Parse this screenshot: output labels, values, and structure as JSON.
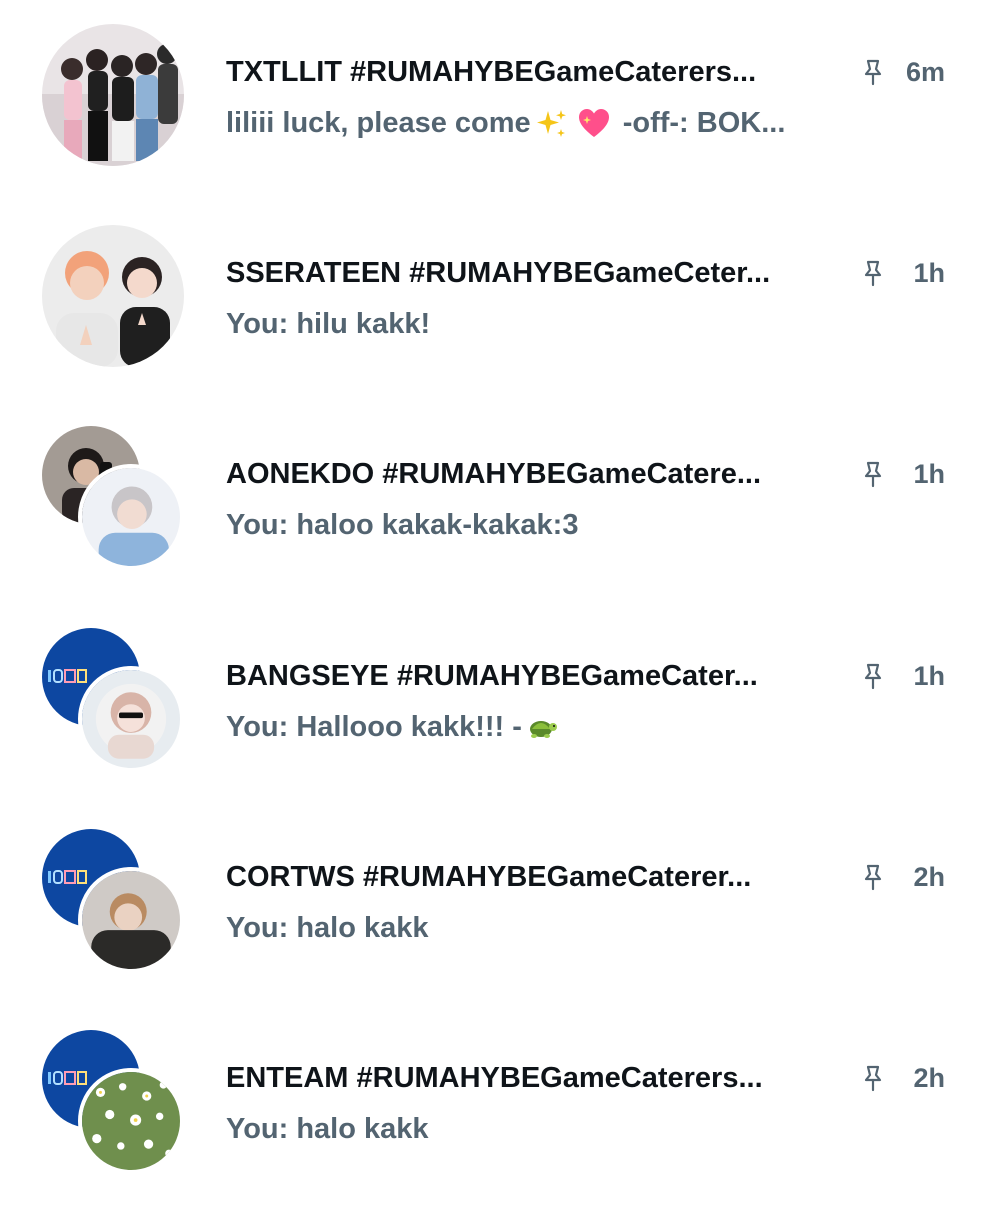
{
  "conversations": [
    {
      "name": "TXTLLIT #RUMAHYBEGameCaterers...",
      "message_text": "liliii luck, please come",
      "message_emoji": [
        "sparkles-emoji",
        "sparkling-heart-emoji"
      ],
      "message_suffix": "-off-: BOK...",
      "time": "6m",
      "avatar": "single"
    },
    {
      "name": "SSERATEEN #RUMAHYBEGameCeter...",
      "message_text": "You: hilu kakk!",
      "time": "1h",
      "avatar": "single"
    },
    {
      "name": "AONEKDO #RUMAHYBEGameCatere...",
      "message_text": "You: haloo kakak-kakak:3",
      "time": "1h",
      "avatar": "group"
    },
    {
      "name": "BANGSEYE #RUMAHYBEGameCater...",
      "message_text": "You: Hallooo kakk!!! -",
      "message_emoji": [
        "turtle-emoji"
      ],
      "time": "1h",
      "avatar": "group"
    },
    {
      "name": "CORTWS #RUMAHYBEGameCaterer...",
      "message_text": "You: halo kakk",
      "time": "2h",
      "avatar": "group"
    },
    {
      "name": "ENTEAM #RUMAHYBEGameCaterers...",
      "message_text": "You: halo kakk",
      "time": "2h",
      "avatar": "group"
    }
  ],
  "colors": {
    "name_text": "#0f1419",
    "secondary_text": "#536471",
    "group_logo_bg": "#0d47a1",
    "background": "#ffffff"
  },
  "icons": {
    "pin": "pin-icon"
  }
}
